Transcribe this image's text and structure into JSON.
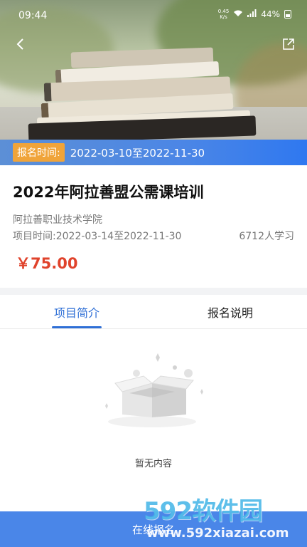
{
  "status_bar": {
    "time": "09:44",
    "net_speed_value": "0.45",
    "net_speed_unit": "K/s",
    "battery": "44%"
  },
  "banner": {
    "reg_label": "报名时间:",
    "reg_value": "2022-03-10至2022-11-30"
  },
  "course": {
    "title": "2022年阿拉善盟公需课培训",
    "school": "阿拉善职业技术学院",
    "period": "项目时间:2022-03-14至2022-11-30",
    "learners": "6712人学习",
    "price": "￥75.00"
  },
  "tabs": [
    {
      "label": "项目简介",
      "active": true
    },
    {
      "label": "报名说明",
      "active": false
    }
  ],
  "empty_state": {
    "text": "暂无内容"
  },
  "bottom_bar": {
    "label": "在线报名"
  },
  "watermark": {
    "logo": "592软件园",
    "url": "www.592xiazai.com"
  },
  "colors": {
    "accent": "#2f6fd6",
    "price": "#e0432c",
    "reg_label_bg": "#f0a43a",
    "bottom_bar": "#4a86e8"
  }
}
